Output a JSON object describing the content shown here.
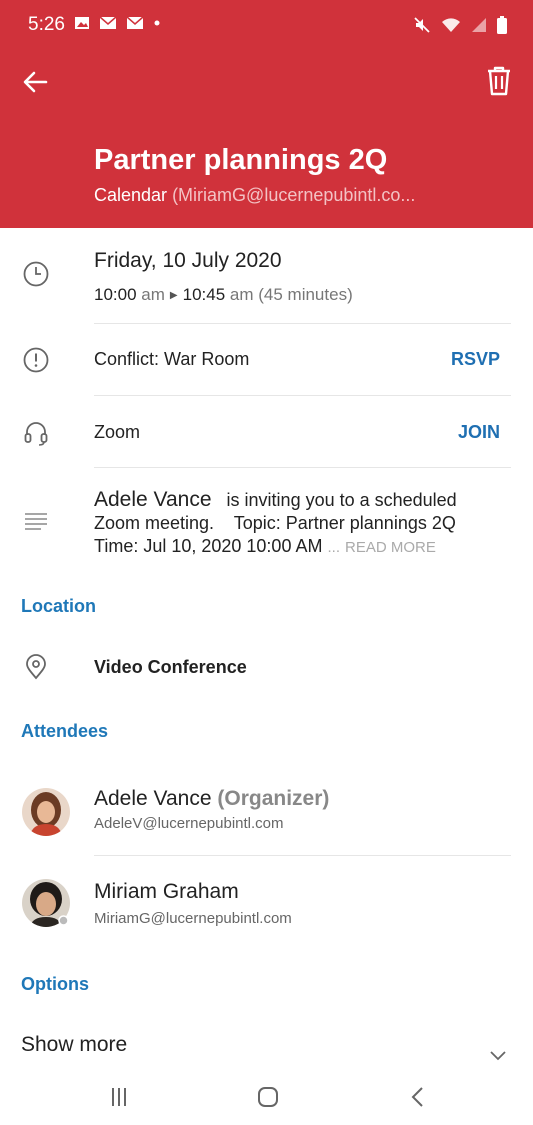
{
  "status_bar": {
    "time": "5:26",
    "notification_icons": [
      "image-icon",
      "mail-icon",
      "mail-icon",
      "dot-icon"
    ],
    "right_icons": [
      "mute-icon",
      "wifi-icon",
      "signal-icon",
      "battery-icon"
    ]
  },
  "header": {
    "title": "Partner plannings 2Q",
    "calendar_label": "Calendar",
    "calendar_account": "(MiriamG@lucernepubintl.co...",
    "bg_color": "#d0323b"
  },
  "when": {
    "date": "Friday, 10 July 2020",
    "start": "10:00",
    "start_suffix": "am",
    "end": "10:45",
    "end_suffix": "am",
    "duration": "(45 minutes)"
  },
  "conflict": {
    "label": "Conflict: War Room",
    "action": "RSVP"
  },
  "online_meeting": {
    "label": "Zoom",
    "action": "JOIN"
  },
  "description": {
    "inviter": "Adele Vance",
    "line1_rest": "is inviting you to a scheduled",
    "line2": "Zoom meeting.    Topic: Partner plannings 2Q",
    "line3": "Time: Jul 10, 2020 10:00 AM",
    "ellipsis": "...",
    "read_more": "READ MORE"
  },
  "location": {
    "heading": "Location",
    "value": "Video Conference"
  },
  "attendees": {
    "heading": "Attendees",
    "list": [
      {
        "name": "Adele Vance",
        "role": "(Organizer)",
        "email": "AdeleV@lucernepubintl.com"
      },
      {
        "name": "Miriam Graham",
        "role": "",
        "email": "MiriamG@lucernepubintl.com"
      }
    ]
  },
  "options": {
    "heading": "Options",
    "show_more": "Show more"
  },
  "nav": {
    "icons": [
      "recent-apps-icon",
      "home-icon",
      "back-icon"
    ]
  },
  "colors": {
    "accent_blue": "#1f78b8",
    "action_blue": "#1f6fb2"
  }
}
